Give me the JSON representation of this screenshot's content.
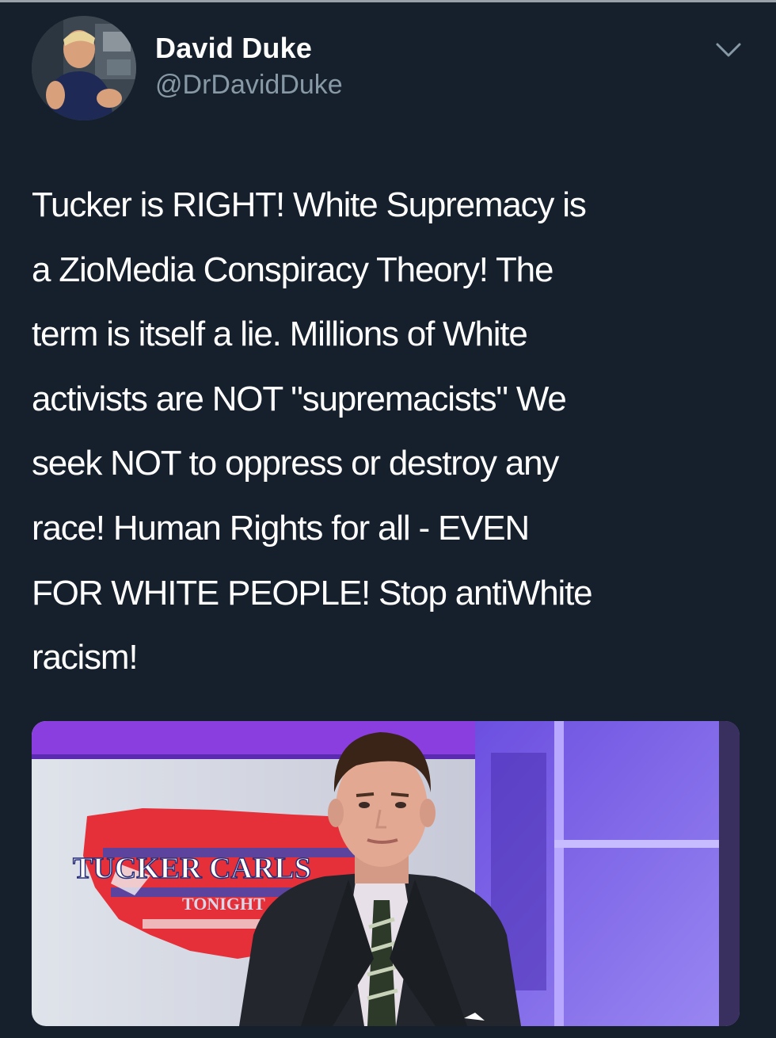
{
  "tweet": {
    "author": {
      "display_name": "David Duke",
      "handle": "@DrDavidDuke"
    },
    "text": "Tucker is RIGHT! White Supremacy is\na ZioMedia Conspiracy Theory! The\nterm is itself a lie. Millions of White\nactivists are NOT \"supremacists\" We\nseek NOT to oppress or destroy any\nrace! Human Rights for all - EVEN\nFOR WHITE PEOPLE! Stop antiWhite\nracism!",
    "media": {
      "overlay_text": "TUCKER CARLS",
      "overlay_subtext": "TONIGHT"
    },
    "icons": {
      "menu": "chevron-down-icon"
    }
  },
  "colors": {
    "background": "#16202c",
    "secondary_text": "#8899a6",
    "primary_text": "#ffffff"
  }
}
